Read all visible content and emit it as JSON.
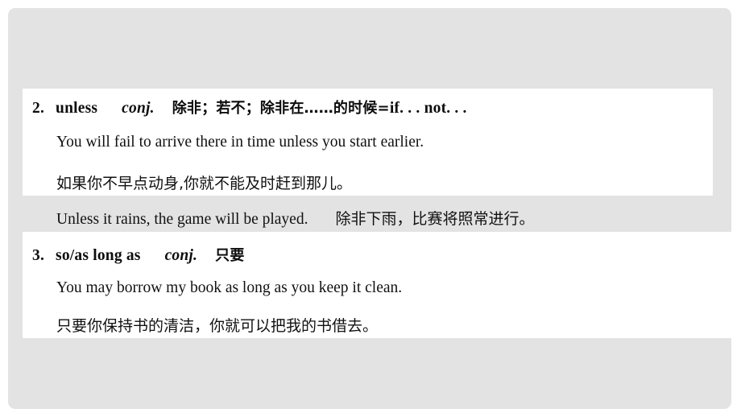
{
  "slide": {
    "background_color": "#e3e3e3",
    "panel_color": "#ffffff",
    "text_color": "#111111"
  },
  "entries": [
    {
      "number": "2.",
      "term": "unless",
      "part_of_speech": "conj.",
      "gloss_cn": "除非；若不；除非在……的时候=",
      "gloss_tail": "if. . . not. . .",
      "examples": [
        {
          "en": "You will fail to arrive there in time unless you start earlier.",
          "cn": "如果你不早点动身,你就不能及时赶到那儿。"
        }
      ]
    },
    {
      "number": "3.",
      "term": "so/as long as",
      "part_of_speech": "conj.",
      "gloss_cn": "只要",
      "gloss_tail": "",
      "examples": [
        {
          "en": "You may borrow my book as long as you keep it clean.",
          "cn": "只要你保持书的清洁，你就可以把我的书借去。"
        }
      ]
    }
  ],
  "highlight_example": {
    "en": "Unless it rains, the game will be played.",
    "cn": "除非下雨，比赛将照常进行。"
  }
}
